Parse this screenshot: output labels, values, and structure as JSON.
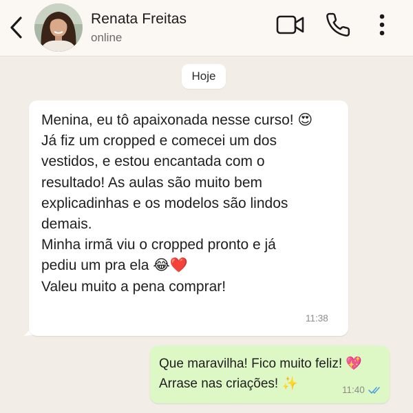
{
  "header": {
    "contact_name": "Renata Freitas",
    "status": "online",
    "icons": [
      "back-arrow-icon",
      "video-camera-icon",
      "phone-icon",
      "more-vertical-icon"
    ]
  },
  "chat": {
    "date_label": "Hoje",
    "messages": [
      {
        "direction": "incoming",
        "text": "Menina, eu tô apaixonada nesse curso! 😍\nJá fiz um cropped e comecei um dos\nvestidos, e estou encantada com o\nresultado! As aulas são muito bem\nexplicadinhas e os modelos são lindos\ndemais.\nMinha irmã viu o cropped pronto e já\npediu um pra ela 😂❤️\nValeu muito a pena comprar!",
        "time": "11:38"
      },
      {
        "direction": "outgoing",
        "text": "Que maravilha! Fico muito feliz! 💖\nArrase nas criações! ✨",
        "time": "11:40",
        "read_status": "read"
      }
    ]
  },
  "colors": {
    "incoming_bubble": "#ffffff",
    "outgoing_bubble": "#ddf7c5",
    "chat_background": "#f2ede6",
    "read_ticks": "#4aa3df"
  }
}
